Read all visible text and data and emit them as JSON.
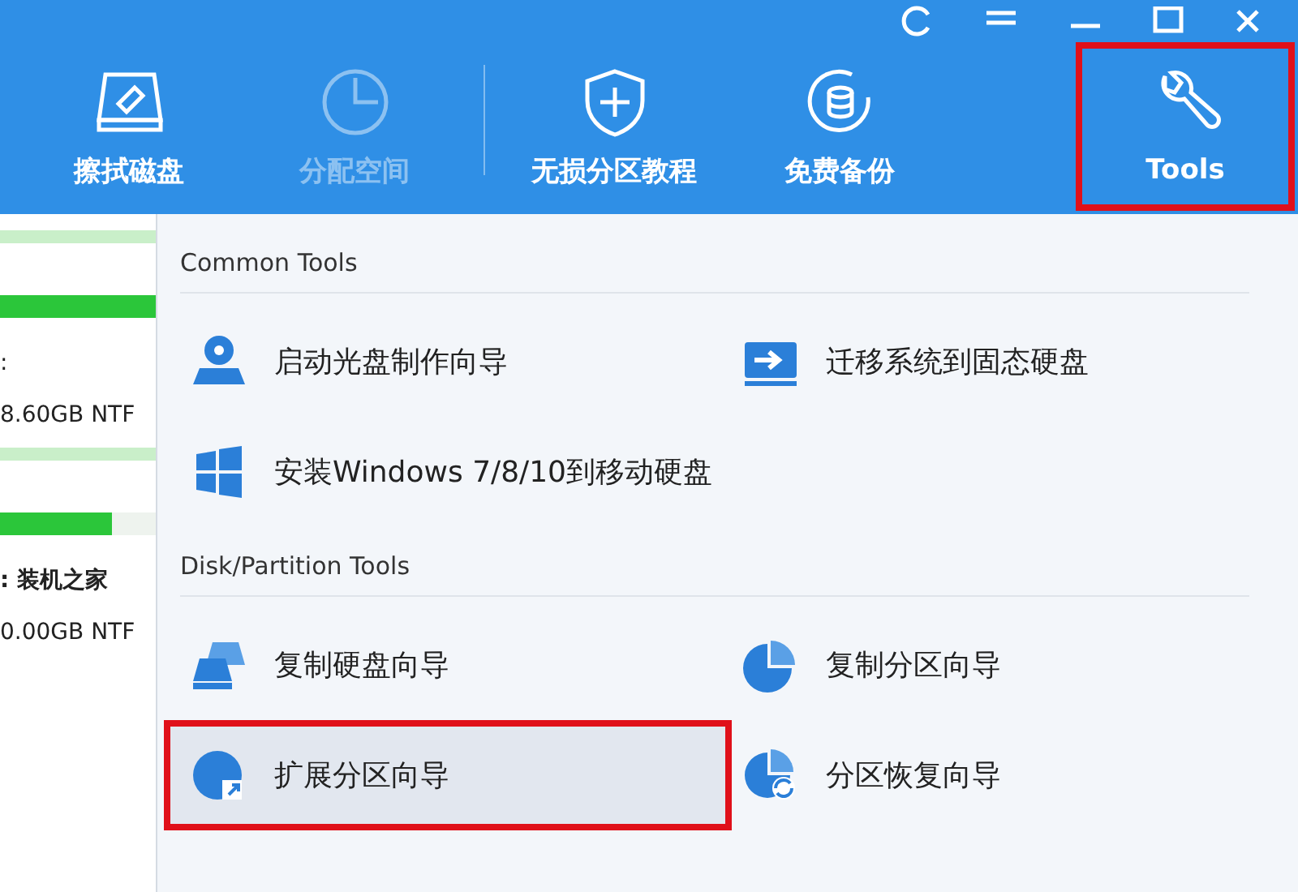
{
  "toolbar": [
    {
      "label": "擦拭磁盘",
      "disabled": false,
      "highlighted": false
    },
    {
      "label": "分配空间",
      "disabled": true,
      "highlighted": false
    },
    {
      "label": "无损分区教程",
      "disabled": false,
      "highlighted": false
    },
    {
      "label": "免费备份",
      "disabled": false,
      "highlighted": false
    },
    {
      "label": "Tools",
      "disabled": false,
      "highlighted": true
    }
  ],
  "left_panel": [
    {
      "kind": "strip"
    },
    {
      "kind": "bar",
      "level": 1
    },
    {
      "kind": "label",
      "text": ":",
      "bold": false
    },
    {
      "kind": "label",
      "text": "8.60GB NTF",
      "bold": false
    },
    {
      "kind": "strip"
    },
    {
      "kind": "bar",
      "level": 0.72
    },
    {
      "kind": "label",
      "text": ": 装机之家",
      "bold": true
    },
    {
      "kind": "label",
      "text": "0.00GB NTF",
      "bold": false
    }
  ],
  "menu": {
    "sections": [
      {
        "title": "Common Tools",
        "items": [
          {
            "label": "启动光盘制作向导",
            "highlighted": false
          },
          {
            "label": "迁移系统到固态硬盘",
            "highlighted": false
          },
          {
            "label": "安装Windows 7/8/10到移动硬盘",
            "highlighted": false
          }
        ]
      },
      {
        "title": "Disk/Partition Tools",
        "items": [
          {
            "label": "复制硬盘向导",
            "highlighted": false
          },
          {
            "label": "复制分区向导",
            "highlighted": false
          },
          {
            "label": "扩展分区向导",
            "highlighted": true
          },
          {
            "label": "分区恢复向导",
            "highlighted": false
          }
        ]
      }
    ]
  }
}
